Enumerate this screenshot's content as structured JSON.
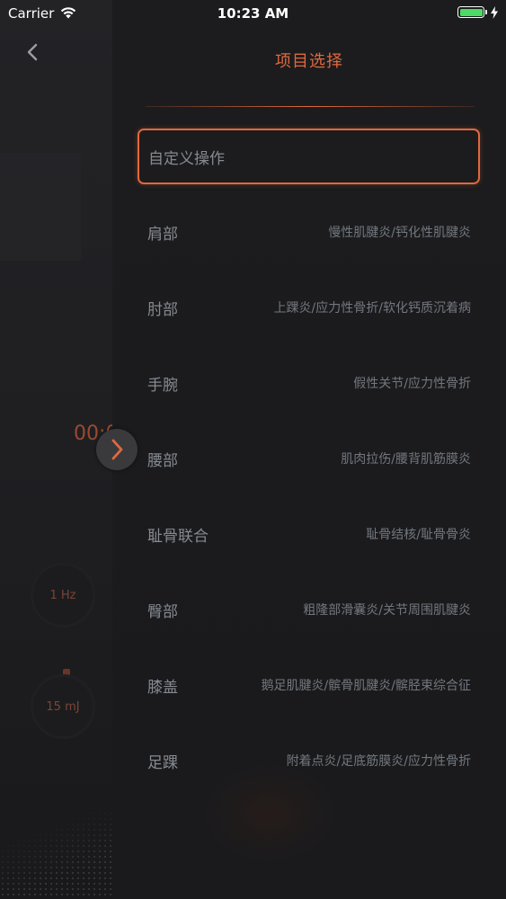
{
  "status_bar": {
    "carrier": "Carrier",
    "time": "10:23 AM",
    "battery_color": "#4cd964"
  },
  "background": {
    "timer_text": "00:0",
    "frequency": "1 Hz",
    "energy": "15 mJ"
  },
  "header": {
    "title": "项目选择",
    "accent_color": "#e2683d",
    "back_icon": "chevron-left-icon"
  },
  "handle_icon": "chevron-right-icon",
  "items": [
    {
      "name": "自定义操作",
      "desc": "",
      "selected": true
    },
    {
      "name": "肩部",
      "desc": "慢性肌腱炎/钙化性肌腱炎"
    },
    {
      "name": "肘部",
      "desc": "上踝炎/应力性骨折/软化钙质沉着病"
    },
    {
      "name": "手腕",
      "desc": "假性关节/应力性骨折"
    },
    {
      "name": "腰部",
      "desc": "肌肉拉伤/腰背肌筋膜炎"
    },
    {
      "name": "耻骨联合",
      "desc": "耻骨结核/耻骨骨炎"
    },
    {
      "name": "臀部",
      "desc": "粗隆部滑囊炎/关节周围肌腱炎"
    },
    {
      "name": "膝盖",
      "desc": "鹅足肌腱炎/髌骨肌腱炎/髌胫束综合征"
    },
    {
      "name": "足踝",
      "desc": "附着点炎/足底筋膜炎/应力性骨折"
    }
  ]
}
